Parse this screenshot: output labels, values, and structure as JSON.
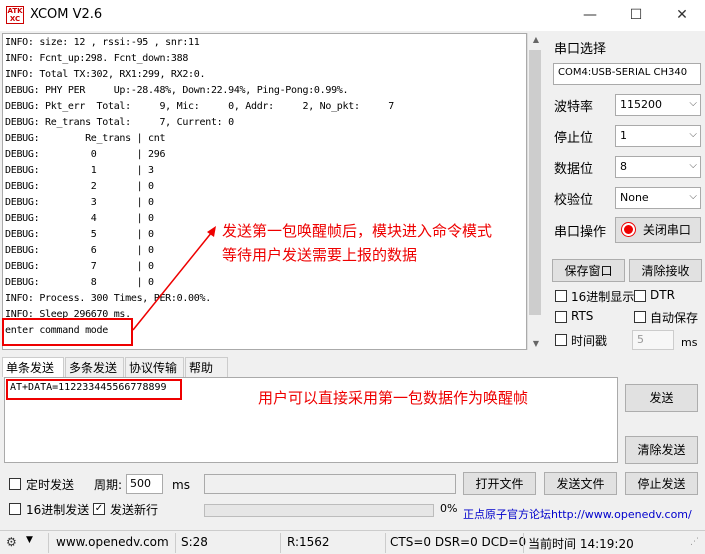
{
  "window": {
    "title": "XCOM V2.6",
    "logo": "ATK XCOM",
    "minimize": "—",
    "maximize": "☐",
    "close": "✕"
  },
  "receive": {
    "lines": [
      "INFO: size: 12 , rssi:-95 , snr:11",
      "INFO: Fcnt_up:298. Fcnt_down:388",
      "INFO: Total TX:302, RX1:299, RX2:0.",
      "DEBUG: PHY PER     Up:-28.48%, Down:22.94%, Ping-Pong:0.99%.",
      "DEBUG: Pkt_err  Total:     9, Mic:     0, Addr:     2, No_pkt:     7",
      "DEBUG: Re_trans Total:     7, Current: 0",
      "DEBUG:        Re_trans | cnt",
      "DEBUG:         0       | 296",
      "DEBUG:         1       | 3",
      "DEBUG:         2       | 0",
      "DEBUG:         3       | 0",
      "DEBUG:         4       | 0",
      "DEBUG:         5       | 0",
      "DEBUG:         6       | 0",
      "DEBUG:         7       | 0",
      "DEBUG:         8       | 0",
      "INFO: Process. 300 Times, PER:0.00%.",
      "INFO: Sleep 296670 ms.",
      "enter command mode"
    ]
  },
  "panel": {
    "port_select_label": "串口选择",
    "port_value": "COM4:USB-SERIAL CH340",
    "baud_label": "波特率",
    "baud_value": "115200",
    "stop_label": "停止位",
    "stop_value": "1",
    "data_label": "数据位",
    "data_value": "8",
    "parity_label": "校验位",
    "parity_value": "None",
    "op_label": "串口操作",
    "close_port": "关闭串口",
    "save_window": "保存窗口",
    "clear_recv": "清除接收",
    "hex_display": "16进制显示",
    "dtr": "DTR",
    "rts": "RTS",
    "auto_save": "自动保存",
    "timestamp": "时间戳",
    "timestamp_value": "5",
    "timestamp_unit": "ms"
  },
  "tabs": [
    "单条发送",
    "多条发送",
    "协议传输",
    "帮助"
  ],
  "send": {
    "text": "AT+DATA=112233445566778899",
    "send_btn": "发送",
    "clear_send": "清除发送"
  },
  "bottom": {
    "timed_send": "定时发送",
    "period_label": "周期:",
    "period_value": "500",
    "period_unit": "ms",
    "open_file": "打开文件",
    "send_file": "发送文件",
    "stop_send": "停止发送",
    "hex_send": "16进制发送",
    "send_newline": "发送新行",
    "progress_pct": "0%",
    "forum_link": "正点原子官方论坛http://www.openedv.com/"
  },
  "status": {
    "url": "www.openedv.com",
    "s": "S:28",
    "r": "R:1562",
    "lines": "CTS=0 DSR=0 DCD=0",
    "time": "当前时间 14:19:20"
  },
  "annotations": {
    "recv_note_1": "发送第一包唤醒帧后，模块进入命令模式",
    "recv_note_2": "等待用户发送需要上报的数据",
    "send_note": "用户可以直接采用第一包数据作为唤醒帧"
  },
  "colors": {
    "annotation": "#e00000",
    "accent": "#0078d7"
  }
}
